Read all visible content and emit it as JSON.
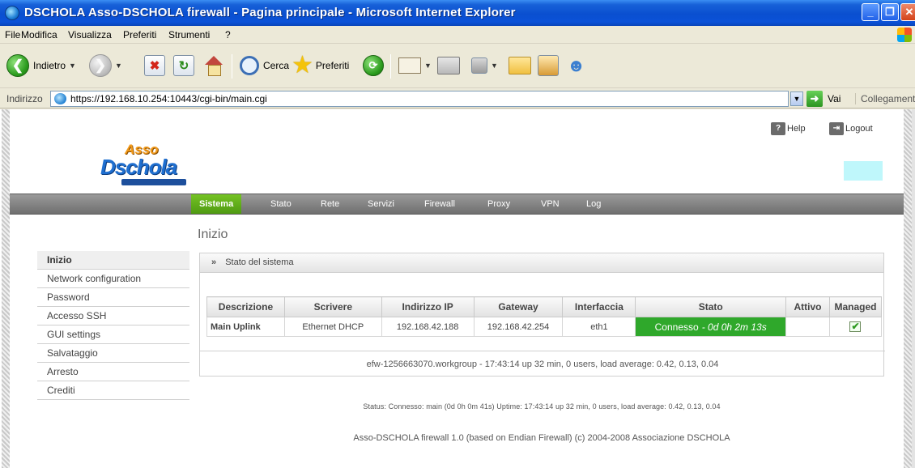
{
  "window": {
    "title": "DSCHOLA Asso-DSCHOLA firewall - Pagina principale - Microsoft Internet Explorer"
  },
  "menu": [
    "File",
    "Modifica",
    "Visualizza",
    "Preferiti",
    "Strumenti",
    "?"
  ],
  "toolbar": {
    "back": "Indietro",
    "search": "Cerca",
    "favorites": "Preferiti"
  },
  "address": {
    "label": "Indirizzo",
    "url": "https://192.168.10.254:10443/cgi-bin/main.cgi",
    "go": "Vai",
    "links": "Collegamenti"
  },
  "header": {
    "logo_top": "Asso",
    "logo_main": "Dschola",
    "help": "Help",
    "logout": "Logout"
  },
  "nav": [
    "Sistema",
    "Stato",
    "Rete",
    "Servizi",
    "Firewall",
    "Proxy",
    "VPN",
    "Log"
  ],
  "page_title": "Inizio",
  "sidebar": [
    "Inizio",
    "Network configuration",
    "Password",
    "Accesso SSH",
    "GUI settings",
    "Salvataggio",
    "Arresto",
    "Crediti"
  ],
  "panel": {
    "chevron": "»",
    "title": "Stato del sistema",
    "columns": [
      "Descrizione",
      "Scrivere",
      "Indirizzo IP",
      "Gateway",
      "Interfaccia",
      "Stato",
      "Attivo",
      "Managed"
    ],
    "row": {
      "descrizione": "Main Uplink",
      "scrivere": "Ethernet DHCP",
      "ip": "192.168.42.188",
      "gateway": "192.168.42.254",
      "interfaccia": "eth1",
      "stato": "Connesso",
      "uptime": "- 0d 0h 2m 13s",
      "attivo": "",
      "managed": "✔"
    },
    "summary": "efw-1256663070.workgroup - 17:43:14 up 32 min, 0 users, load average: 0.42, 0.13, 0.04"
  },
  "status_line": "Status: Connesso: main (0d 0h 0m 41s) Uptime: 17:43:14 up 32 min, 0 users, load average: 0.42, 0.13, 0.04",
  "footer": "Asso-DSCHOLA firewall 1.0 (based on Endian Firewall) (c) 2004-2008 Associazione DSCHOLA"
}
